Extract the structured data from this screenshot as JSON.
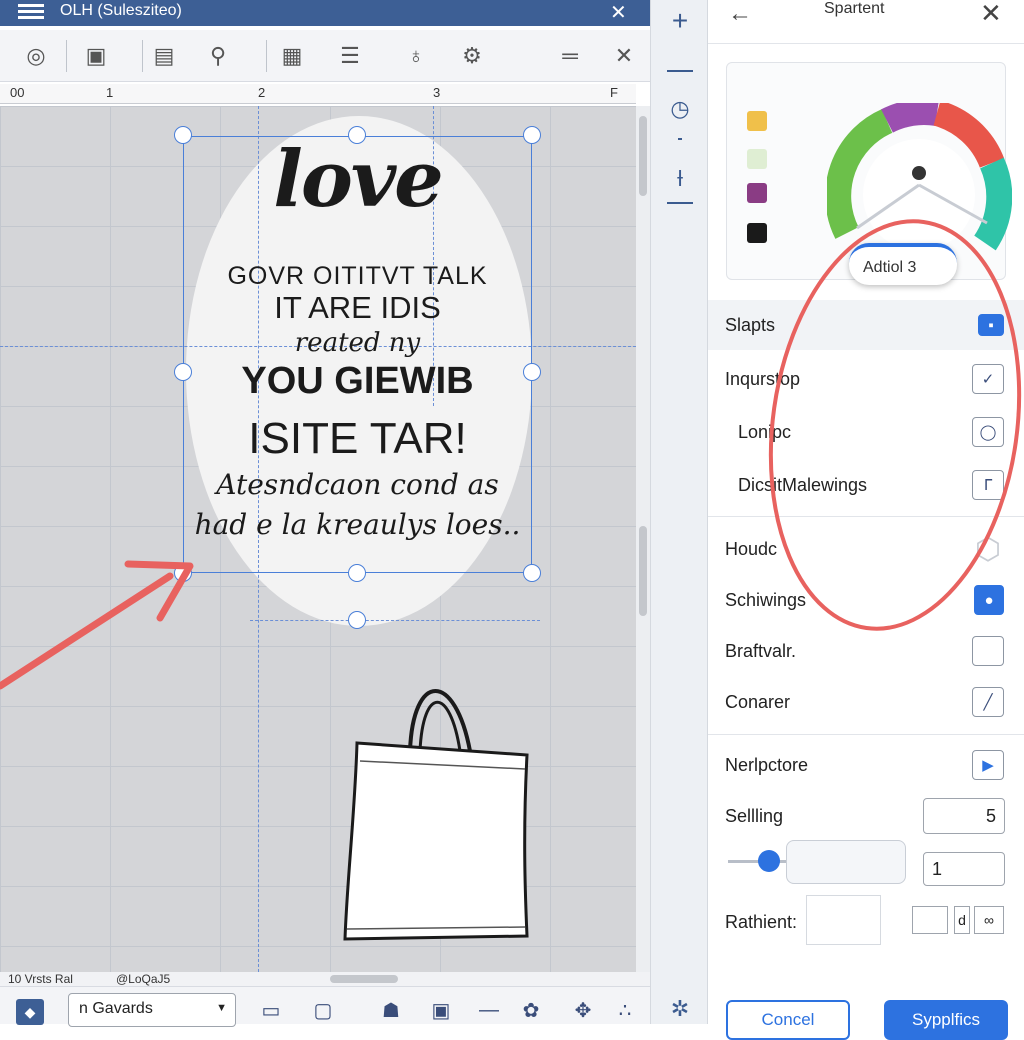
{
  "window": {
    "title": "OLH (Sulesziteo)"
  },
  "ruler": {
    "marks": [
      "00",
      "1",
      "2",
      "3",
      "F"
    ]
  },
  "design": {
    "lines": [
      "love",
      "GOVR OITITVT TALK",
      "IT ARE IDIS",
      "reated ny",
      "YOU GIEWIB",
      "ISITE TAR!",
      "Atesndcaon cond as",
      "had e la kreaulys loes.."
    ]
  },
  "status": {
    "left": "10 Vrsts  Ral",
    "right": "@LoQaJ5"
  },
  "bottom": {
    "layer_select": "n Gavards"
  },
  "panel": {
    "title": "Spartent",
    "add_badge": "Adtiol  3",
    "swatches": [
      "#f0c04a",
      "#dfeed3",
      "#8a3c84",
      "#1a1a1a"
    ],
    "rows": [
      {
        "label": "Slapts"
      },
      {
        "label": "Inqurstop"
      },
      {
        "label": "Lonipc"
      },
      {
        "label": "DicsitMalewings"
      },
      {
        "label": "Houdc"
      },
      {
        "label": "Schiwings"
      },
      {
        "label": "Braftvalr."
      },
      {
        "label": "Conarer"
      },
      {
        "label": "Nerlpctore"
      },
      {
        "label": "Sellling"
      },
      {
        "label": "Rathient:"
      }
    ],
    "value_5": "5",
    "value_1": "1",
    "cancel": "Concel",
    "apply": "Sypplfics"
  },
  "colors": {
    "accent": "#2d72e0",
    "titlebar": "#3d5f95",
    "annotation": "#e8625f"
  }
}
